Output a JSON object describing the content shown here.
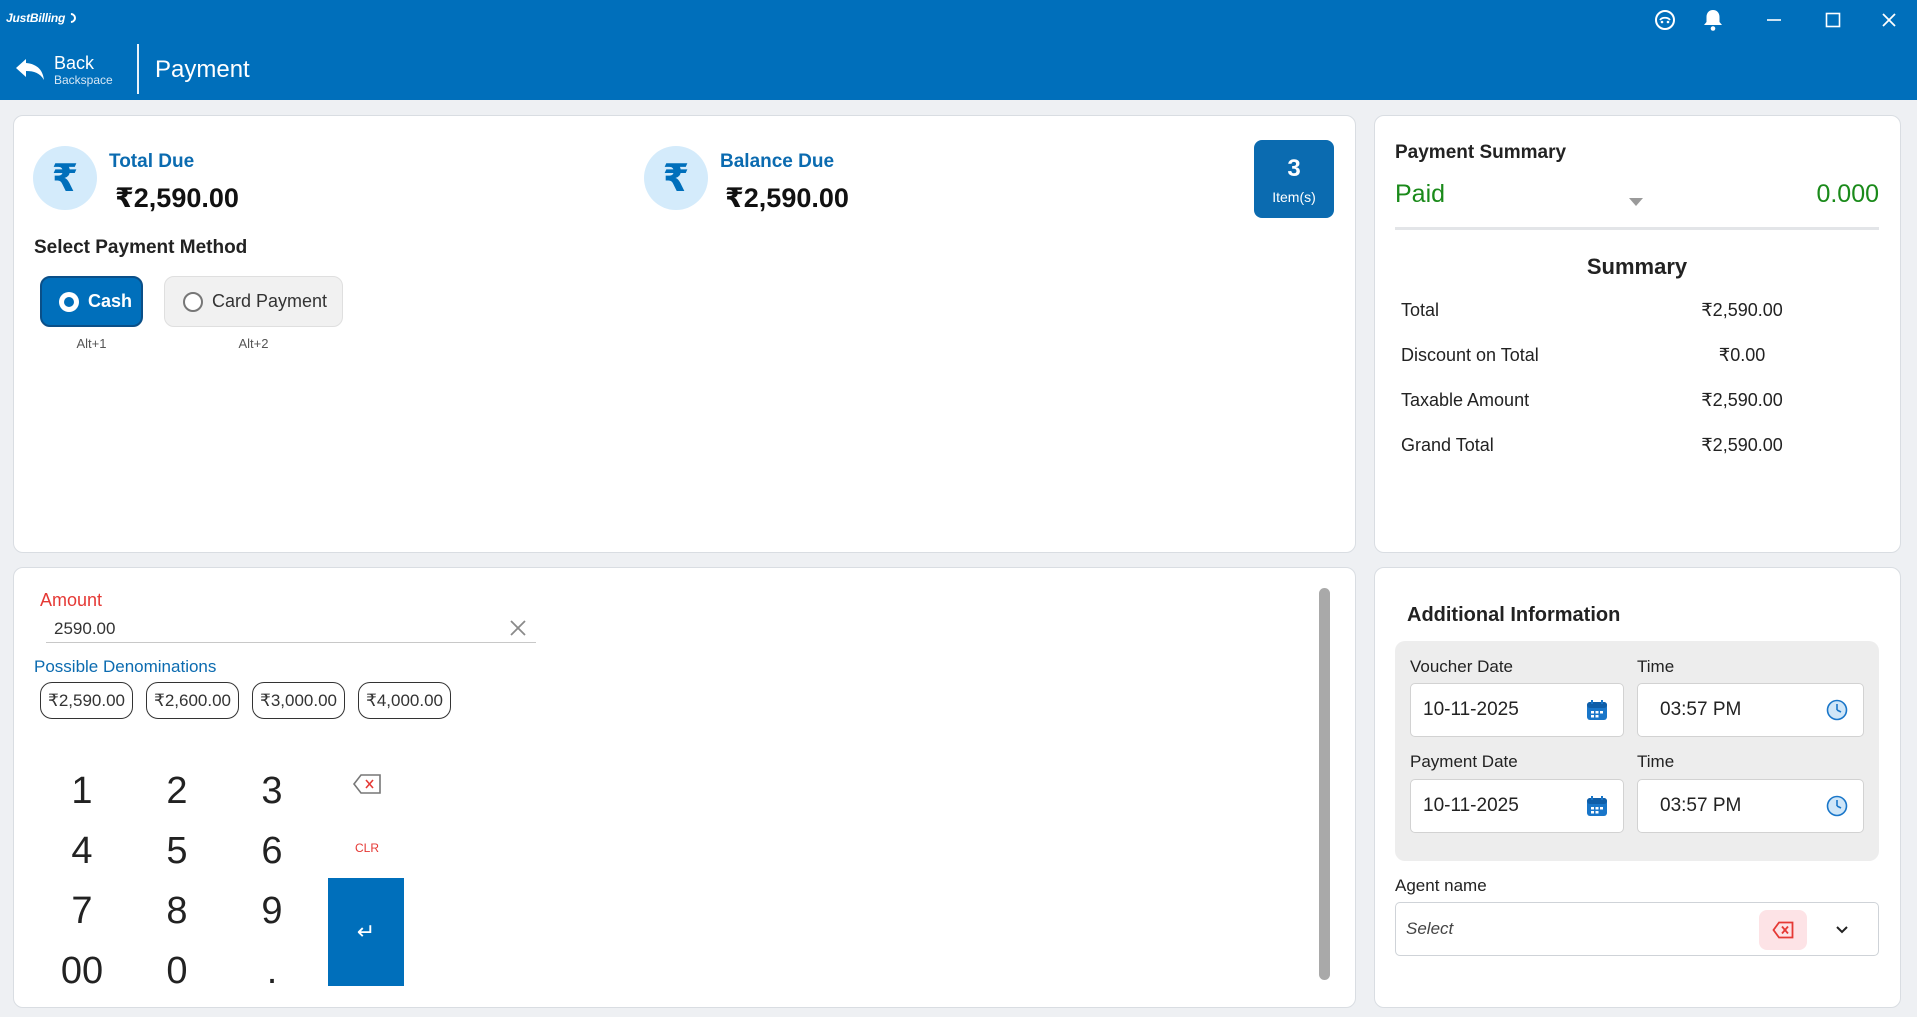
{
  "app": {
    "logo_text": "JustBilling"
  },
  "header": {
    "back_label": "Back",
    "back_hint": "Backspace",
    "title": "Payment"
  },
  "due": {
    "total_label": "Total Due",
    "total_value": "₹2,590.00",
    "balance_label": "Balance Due",
    "balance_value": "₹2,590.00",
    "currency_icon": "₹",
    "items_count": "3",
    "items_label": "Item(s)"
  },
  "payment_method": {
    "title": "Select Payment Method",
    "options": [
      {
        "label": "Cash",
        "shortcut": "Alt+1",
        "selected": true
      },
      {
        "label": "Card Payment",
        "shortcut": "Alt+2",
        "selected": false
      }
    ]
  },
  "payment_summary": {
    "title": "Payment Summary",
    "paid_label": "Paid",
    "paid_value": "0.000",
    "summary_title": "Summary",
    "rows": [
      {
        "label": "Total",
        "value": "₹2,590.00"
      },
      {
        "label": "Discount on Total",
        "value": "₹0.00"
      },
      {
        "label": "Taxable Amount",
        "value": "₹2,590.00"
      },
      {
        "label": "Grand Total",
        "value": "₹2,590.00"
      }
    ]
  },
  "amount": {
    "label": "Amount",
    "value": "2590.00",
    "denominations_label": "Possible Denominations",
    "denominations": [
      "₹2,590.00",
      "₹2,600.00",
      "₹3,000.00",
      "₹4,000.00"
    ]
  },
  "keypad": {
    "keys": [
      "1",
      "2",
      "3",
      "4",
      "5",
      "6",
      "7",
      "8",
      "9",
      "00",
      "0",
      "."
    ],
    "clear_label": "CLR",
    "enter_symbol": "↵"
  },
  "additional_info": {
    "title": "Additional Information",
    "voucher_date_label": "Voucher Date",
    "voucher_date": "10-11-2025",
    "voucher_time_label": "Time",
    "voucher_time": "03:57 PM",
    "payment_date_label": "Payment Date",
    "payment_date": "10-11-2025",
    "payment_time_label": "Time",
    "payment_time": "03:57 PM",
    "agent_label": "Agent name",
    "agent_placeholder": "Select"
  },
  "colors": {
    "primary": "#006fbb",
    "paid_green": "#1a8a1a",
    "danger_red": "#e53935"
  }
}
